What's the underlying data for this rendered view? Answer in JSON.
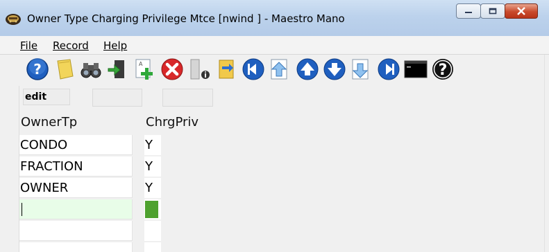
{
  "window": {
    "title": "Owner Type Charging Privilege Mtce [nwind   ] - Maestro Mano",
    "controls": [
      "minimize",
      "maximize",
      "close"
    ]
  },
  "menu": {
    "items": [
      {
        "label": "File"
      },
      {
        "label": "Record"
      },
      {
        "label": "Help"
      }
    ]
  },
  "toolbar": {
    "buttons": [
      {
        "icon": "help-icon"
      },
      {
        "icon": "note-icon"
      },
      {
        "icon": "binoculars-icon"
      },
      {
        "icon": "exit-door-icon"
      },
      {
        "icon": "add-record-icon"
      },
      {
        "icon": "delete-icon"
      },
      {
        "icon": "info-icon"
      },
      {
        "icon": "refresh-icon"
      },
      {
        "icon": "first-record-icon"
      },
      {
        "icon": "page-up-icon"
      },
      {
        "icon": "previous-record-icon"
      },
      {
        "icon": "next-record-icon"
      },
      {
        "icon": "page-down-icon"
      },
      {
        "icon": "last-record-icon"
      },
      {
        "icon": "console-icon"
      },
      {
        "icon": "question-icon"
      }
    ]
  },
  "status": {
    "mode": "edit",
    "field2": "",
    "field3": ""
  },
  "grid": {
    "columns": [
      "OwnerTp",
      "ChrgPriv"
    ],
    "rows": [
      {
        "owner_type": "CONDO",
        "charging_privilege": "Y"
      },
      {
        "owner_type": "FRACTION",
        "charging_privilege": "Y"
      },
      {
        "owner_type": "OWNER",
        "charging_privilege": "Y"
      },
      {
        "owner_type": "",
        "charging_privilege": "",
        "active": true
      },
      {
        "owner_type": "",
        "charging_privilege": ""
      },
      {
        "owner_type": "",
        "charging_privilege": ""
      }
    ]
  },
  "colors": {
    "titlebar": "#bcd2ec",
    "active_row": "#e8fde8",
    "active_privilege": "#4ea12f",
    "close_button": "#c94a2c"
  }
}
